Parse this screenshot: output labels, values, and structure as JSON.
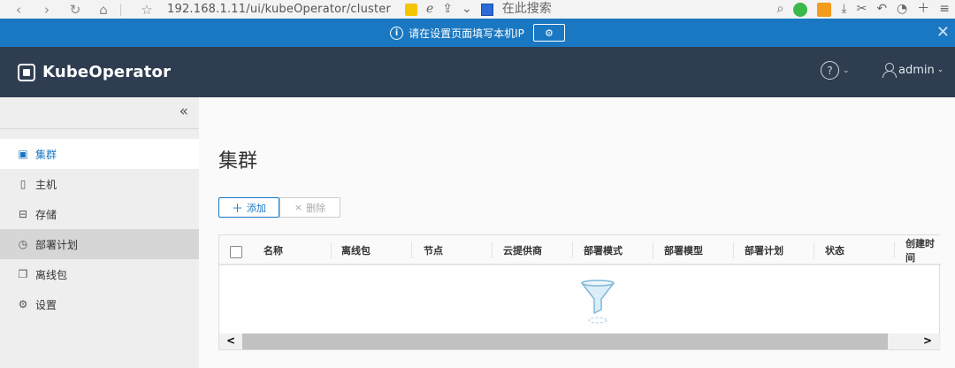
{
  "browser": {
    "back": "‹",
    "forward": "›",
    "reload": "↻",
    "home": "⌂",
    "favorite": "☆",
    "url": "192.168.1.11/ui/kubeOperator/cluster",
    "search_placeholder": "在此搜索"
  },
  "notice": {
    "text": "请在设置页面填写本机IP",
    "button_icon": "gear-icon"
  },
  "header": {
    "brand": "KubeOperator",
    "help_icon": "question-circle-icon",
    "user": "admin"
  },
  "sidebar": {
    "collapse_label": "«",
    "items": [
      {
        "label": "集群",
        "icon": "cluster-icon",
        "active": true
      },
      {
        "label": "主机",
        "icon": "host-icon"
      },
      {
        "label": "存储",
        "icon": "storage-icon"
      },
      {
        "label": "部署计划",
        "icon": "plan-icon",
        "hover": true
      },
      {
        "label": "离线包",
        "icon": "package-icon"
      },
      {
        "label": "设置",
        "icon": "settings-icon"
      }
    ]
  },
  "main": {
    "title": "集群",
    "add_label": "添加",
    "delete_label": "删除",
    "columns": [
      "名称",
      "离线包",
      "节点",
      "云提供商",
      "部署模式",
      "部署模型",
      "部署计划",
      "状态",
      "创建时间"
    ]
  },
  "colors": {
    "accent": "#1a78c2",
    "header_bg": "#2e3d50",
    "notice_bg": "#1a78c2"
  }
}
